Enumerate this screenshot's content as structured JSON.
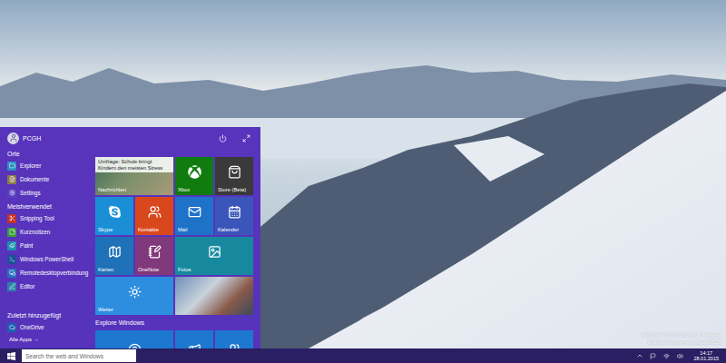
{
  "start_menu": {
    "user": "PCGH",
    "sections": [
      {
        "title": "Orte",
        "items": [
          {
            "label": "Explorer",
            "color": "#2a8fbf"
          },
          {
            "label": "Dokumente",
            "color": "#8a7a4a"
          },
          {
            "label": "Settings",
            "color": "#5a3fc0"
          }
        ]
      },
      {
        "title": "Meistverwendet",
        "items": [
          {
            "label": "Snipping Tool",
            "color": "#c4302b"
          },
          {
            "label": "Kurznotizen",
            "color": "#3a9a3a"
          },
          {
            "label": "Paint",
            "color": "#1f8fae"
          },
          {
            "label": "Windows PowerShell",
            "color": "#1f4f9a"
          },
          {
            "label": "Remotedesktopverbindung",
            "color": "#2a6fbf"
          },
          {
            "label": "Editor",
            "color": "#2a7fa8"
          }
        ]
      },
      {
        "title": "Zuletzt hinzugefügt",
        "items": [
          {
            "label": "OneDrive",
            "color": "#1f5fb0"
          }
        ]
      }
    ],
    "all_apps": "Alle Apps →",
    "tiles_header": "Explore Windows"
  },
  "tiles": [
    {
      "label": "Nachrichten",
      "kind": "photo",
      "headline": "Umfrage: Schule bringt Kindern den meisten Stress"
    },
    {
      "label": "Xbox",
      "kind": "icon",
      "color": "#107c10"
    },
    {
      "label": "Store (Beta)",
      "kind": "icon",
      "color": "#3a3a3a"
    },
    {
      "label": "Skype",
      "kind": "icon",
      "color": "#1a8fd8"
    },
    {
      "label": "Kontakte",
      "kind": "icon",
      "color": "#d9481c"
    },
    {
      "label": "Mail",
      "kind": "icon",
      "color": "#1e72c8"
    },
    {
      "label": "Kalender",
      "kind": "icon",
      "color": "#3b55bb"
    },
    {
      "label": "Karten",
      "kind": "icon",
      "color": "#1f72b8"
    },
    {
      "label": "OneNote",
      "kind": "icon",
      "color": "#80397b"
    },
    {
      "label": "Fotos",
      "kind": "icon",
      "color": "#17899f"
    },
    {
      "label": "Wetter",
      "kind": "icon",
      "color": "#2d8ee0"
    },
    {
      "label": "",
      "kind": "photo",
      "headline": ""
    }
  ],
  "taskbar": {
    "search_placeholder": "Search the web and Windows",
    "time": "14:17",
    "date": "28.01.2015"
  },
  "watermark": {
    "lines": [
      "Windows 10 Pro Technical Preview",
      "Evaluierungsversion. Build 9926"
    ]
  }
}
